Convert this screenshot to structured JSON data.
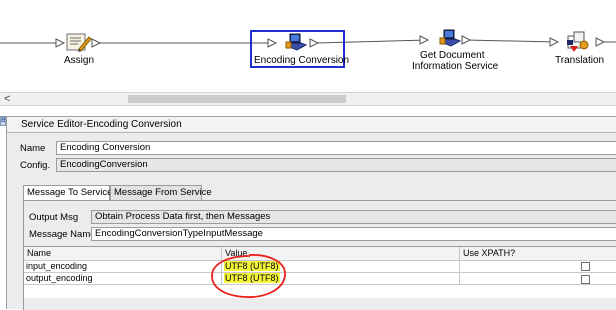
{
  "process_canvas": {
    "nodes": [
      {
        "label": "Assign",
        "icon": "assign-icon"
      },
      {
        "label": "Encoding Conversion",
        "icon": "service-computer-icon",
        "selected": true
      },
      {
        "label_line1": "Get Document",
        "label_line2": "Information Service",
        "icon": "service-computer-icon"
      },
      {
        "label": "Translation",
        "icon": "translation-icon"
      }
    ],
    "selection_color": "#1f2fd0"
  },
  "scrollbar": {
    "left_arrow": "<"
  },
  "side_tab": {
    "text": "BF"
  },
  "editor": {
    "title": "Service Editor-Encoding Conversion",
    "name_label": "Name",
    "name_value": "Encoding Conversion",
    "config_label": "Config.",
    "config_value": "EncodingConversion",
    "tabs": [
      {
        "label": "Message To Service",
        "active": true
      },
      {
        "label": "Message From Service",
        "active": false
      }
    ],
    "output_msg_label": "Output Msg",
    "output_msg_value": "Obtain Process Data first, then Messages",
    "message_name_label": "Message Name",
    "message_name_value": "EncodingConversionTypeInputMessage",
    "table": {
      "columns": [
        "Name",
        "Value",
        "Use XPATH?"
      ],
      "rows": [
        {
          "name": "input_encoding",
          "value": "UTF8 (UTF8)",
          "use_xpath": false
        },
        {
          "name": "output_encoding",
          "value": "UTF8 (UTF8)",
          "use_xpath": false
        }
      ]
    }
  },
  "annotation": {
    "highlight_color": "#f3f53a",
    "circle_color": "#e8211b"
  }
}
